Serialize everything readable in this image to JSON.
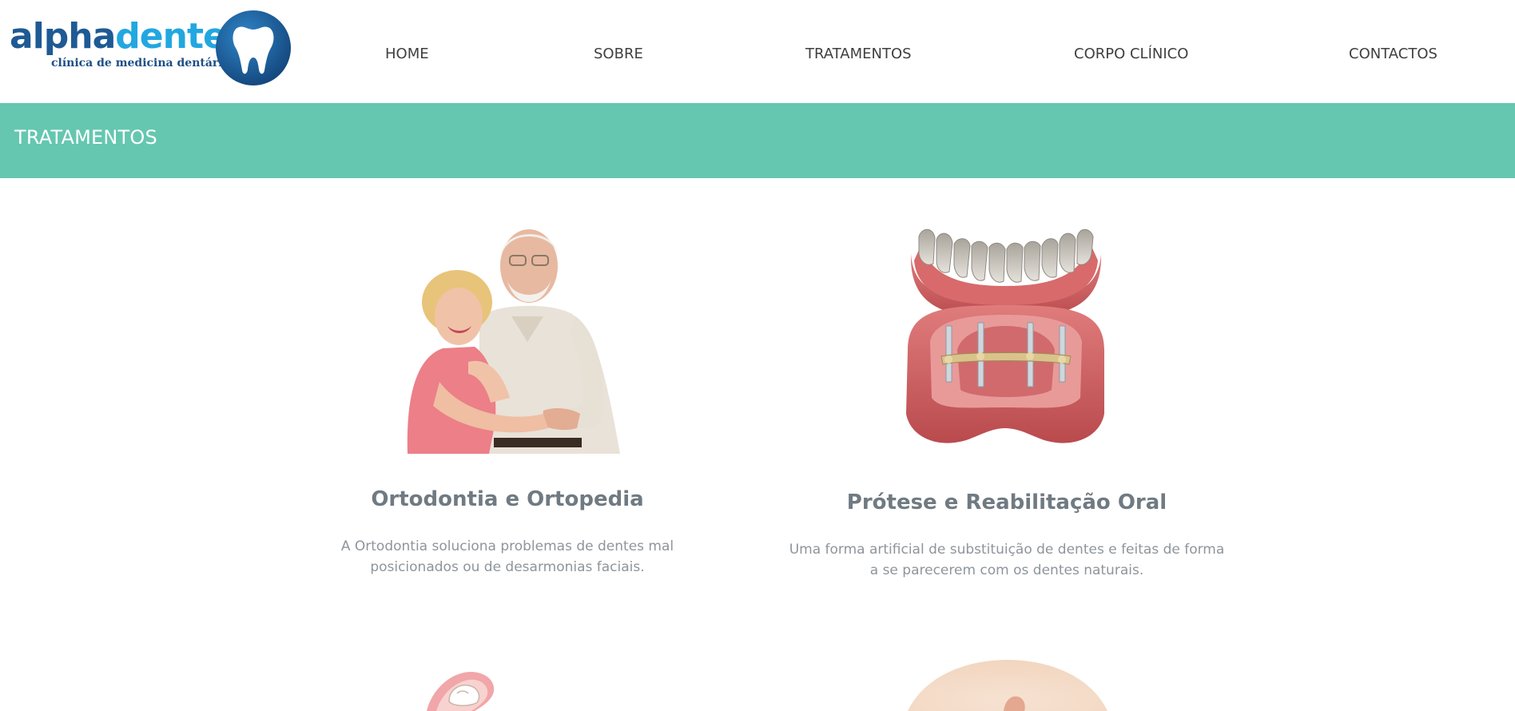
{
  "brand": {
    "name_part1": "alpha",
    "name_part2": "dente",
    "tagline": "clínica de medicina dentária",
    "logo_icon": "tooth-icon"
  },
  "nav": {
    "items": [
      {
        "label": "HOME"
      },
      {
        "label": "SOBRE"
      },
      {
        "label": "TRATAMENTOS"
      },
      {
        "label": "CORPO CLÍNICO"
      },
      {
        "label": "CONTACTOS"
      }
    ]
  },
  "banner": {
    "title": "TRATAMENTOS"
  },
  "treatments": [
    {
      "title": "Ortodontia e Ortopedia",
      "description": "A Ortodontia soluciona problemas de dentes mal posicionados ou de desarmonias faciais.",
      "image": "elderly-couple-photo"
    },
    {
      "title": "Prótese e Reabilitação Oral",
      "description": "Uma forma artificial de substituição de dentes e feitas de forma a se parecerem com os dentes naturais.",
      "image": "dental-prosthesis-model"
    },
    {
      "image": "tooth-crown-illustration"
    },
    {
      "image": "circular-photo"
    }
  ],
  "colors": {
    "banner": "#65c7b0",
    "brand_dark": "#1e5a94",
    "brand_light": "#22a7e0",
    "title_text": "#707a82",
    "body_text": "#8e959b",
    "nav_text": "#3f3f3f"
  }
}
